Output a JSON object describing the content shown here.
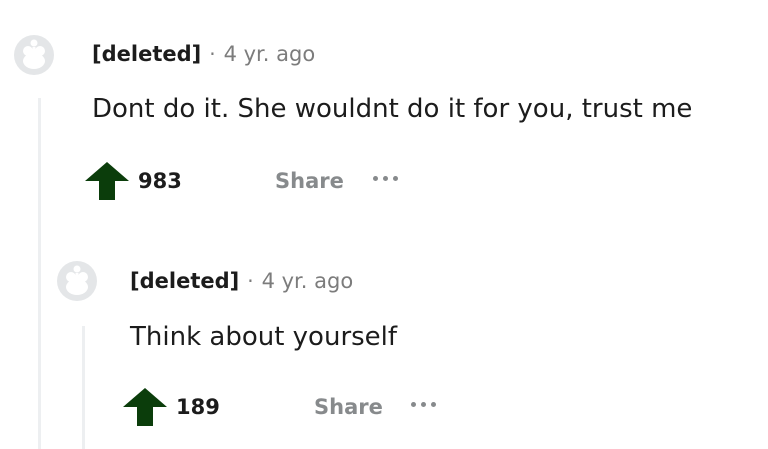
{
  "comments": [
    {
      "author": "[deleted]",
      "separator": "·",
      "time": "4 yr. ago",
      "body": "Dont do it. She wouldnt do it for you, trust me",
      "score": "983",
      "share_label": "Share"
    },
    {
      "author": "[deleted]",
      "separator": "·",
      "time": "4 yr. ago",
      "body": "Think about yourself",
      "score": "189",
      "share_label": "Share"
    }
  ],
  "colors": {
    "upvote": "#0b3d0b",
    "muted": "#878a8c",
    "thread_line": "#edeff1"
  },
  "icons": {
    "avatar": "reddit-snoo-placeholder-icon",
    "upvote": "upvote-arrow-icon",
    "more": "more-options-icon"
  }
}
